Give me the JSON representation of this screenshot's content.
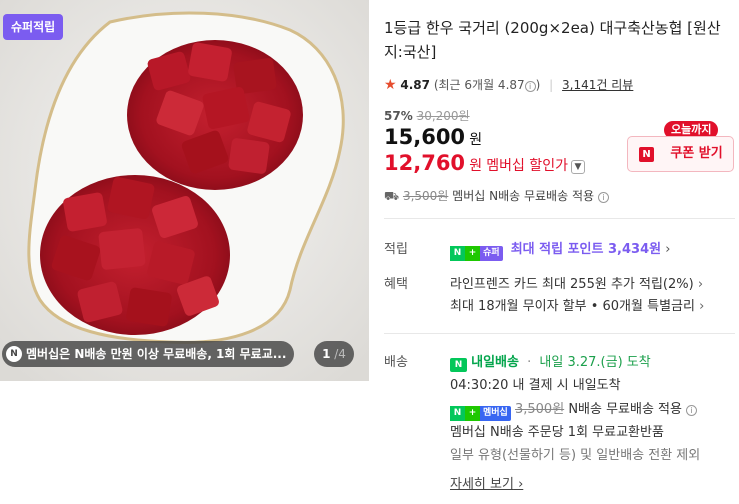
{
  "image_panel": {
    "badge": "슈퍼적립",
    "promo_icon": "N",
    "promo_text": "멤버십은 N배송 만원 이상 무료배송, 1회 무료교...",
    "pager_current": "1",
    "pager_sep": "/",
    "pager_total": "4"
  },
  "product": {
    "title": "1등급 한우 국거리 (200g×2ea) 대구축산농협 [원산지:국산]",
    "rating_star": "★",
    "rating": "4.87",
    "rating_recent": "(최근 6개월 4.87",
    "rating_recent_close": ")",
    "review_count": "3,141건 리뷰",
    "discount_pct": "57%",
    "original_price": "30,200원",
    "price": "15,600",
    "price_unit": "원",
    "member_price": "12,760",
    "member_price_unit": "원",
    "member_label": "멤버십 할인가",
    "shipping_old": "3,500원",
    "shipping_text": "멤버십 N배송 무료배송 적용"
  },
  "coupon": {
    "tag": "오늘까지",
    "button": "쿠폰 받기",
    "icon": "N"
  },
  "points": {
    "label": "적립",
    "badge_n": "N",
    "badge_plus": "+",
    "badge_super": "슈퍼",
    "text": "최대 적립 포인트 3,434원",
    "arrow": "›"
  },
  "benefits": {
    "label": "혜택",
    "items": [
      "라인프렌즈 카드 최대 255원 추가 적립(2%)",
      "최대 18개월 무이자 할부 • 60개월 특별금리"
    ],
    "arrow": "›"
  },
  "delivery": {
    "label": "배송",
    "icon": "N",
    "type": "내일배송",
    "sep": "·",
    "date": "내일 3.27.(금) 도착",
    "deadline": "04:30:20  내 결제 시 내일도착",
    "member_badge": "멤버십",
    "member_old": "3,500원",
    "member_text": "N배송 무료배송 적용",
    "exchange": "멤버십 N배송 주문당 1회 무료교환반품",
    "note": "일부 유형(선물하기 등) 및 일반배송 전환 제외",
    "more": "자세히 보기"
  },
  "colors": {
    "accent_red": "#e1102b",
    "super_purple": "#7b5cf0",
    "naver_green": "#03c75a"
  }
}
